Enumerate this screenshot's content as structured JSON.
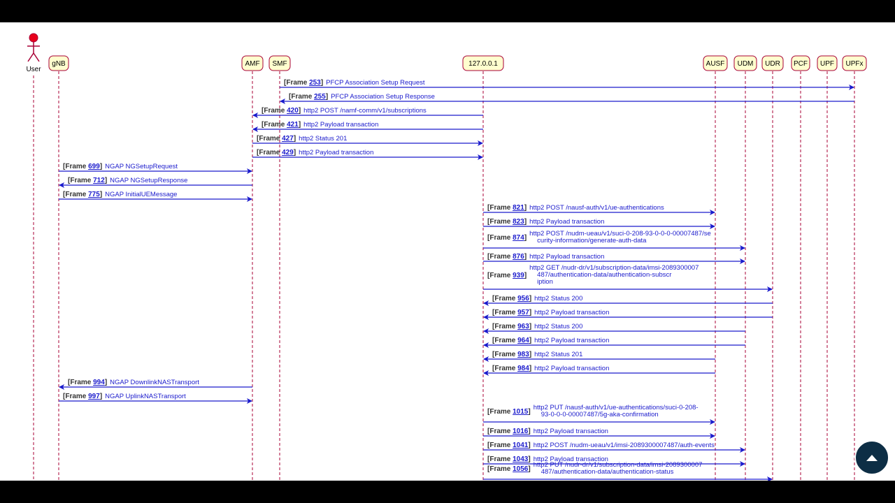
{
  "diagram": {
    "actor": {
      "label": "User"
    },
    "participants": [
      {
        "id": "gnb",
        "label": "gNB"
      },
      {
        "id": "amf",
        "label": "AMF"
      },
      {
        "id": "smf",
        "label": "SMF"
      },
      {
        "id": "ip",
        "label": "127.0.0.1"
      },
      {
        "id": "ausf",
        "label": "AUSF"
      },
      {
        "id": "udm",
        "label": "UDM"
      },
      {
        "id": "udr",
        "label": "UDR"
      },
      {
        "id": "pcf",
        "label": "PCF"
      },
      {
        "id": "upf",
        "label": "UPF"
      },
      {
        "id": "upfx",
        "label": "UPFx"
      }
    ],
    "messages": [
      {
        "frame": "253",
        "from": "smf",
        "to": "upfx",
        "lines": [
          "PFCP Association Setup Request"
        ]
      },
      {
        "frame": "255",
        "from": "upfx",
        "to": "smf",
        "lines": [
          "PFCP Association Setup Response"
        ]
      },
      {
        "frame": "420",
        "from": "ip",
        "to": "amf",
        "lines": [
          "http2 POST /namf-comm/v1/subscriptions"
        ]
      },
      {
        "frame": "421",
        "from": "ip",
        "to": "amf",
        "lines": [
          "http2 Payload transaction"
        ]
      },
      {
        "frame": "427",
        "from": "amf",
        "to": "ip",
        "lines": [
          "http2 Status 201"
        ]
      },
      {
        "frame": "429",
        "from": "amf",
        "to": "ip",
        "lines": [
          "http2 Payload transaction"
        ]
      },
      {
        "frame": "699",
        "from": "gnb",
        "to": "amf",
        "lines": [
          "NGAP NGSetupRequest"
        ]
      },
      {
        "frame": "712",
        "from": "amf",
        "to": "gnb",
        "lines": [
          "NGAP NGSetupResponse"
        ]
      },
      {
        "frame": "775",
        "from": "gnb",
        "to": "amf",
        "lines": [
          "NGAP InitialUEMessage"
        ]
      },
      {
        "frame": "821",
        "from": "ip",
        "to": "ausf",
        "lines": [
          "http2 POST /nausf-auth/v1/ue-authentications"
        ]
      },
      {
        "frame": "823",
        "from": "ip",
        "to": "ausf",
        "lines": [
          "http2 Payload transaction"
        ]
      },
      {
        "frame": "874",
        "from": "ip",
        "to": "udm",
        "lines": [
          "http2 POST /nudm-ueau/v1/suci-0-208-93-0-0-0-00007487/se",
          "curity-information/generate-auth-data"
        ]
      },
      {
        "frame": "876",
        "from": "ip",
        "to": "udm",
        "lines": [
          "http2 Payload transaction"
        ]
      },
      {
        "frame": "939",
        "from": "ip",
        "to": "udr",
        "lines": [
          "http2 GET /nudr-dr/v1/subscription-data/imsi-2089300007",
          "487/authentication-data/authentication-subscr",
          "iption"
        ]
      },
      {
        "frame": "956",
        "from": "udr",
        "to": "ip",
        "lines": [
          "http2 Status 200"
        ]
      },
      {
        "frame": "957",
        "from": "udr",
        "to": "ip",
        "lines": [
          "http2 Payload transaction"
        ]
      },
      {
        "frame": "963",
        "from": "udm",
        "to": "ip",
        "lines": [
          "http2 Status 200"
        ]
      },
      {
        "frame": "964",
        "from": "udm",
        "to": "ip",
        "lines": [
          "http2 Payload transaction"
        ]
      },
      {
        "frame": "983",
        "from": "ausf",
        "to": "ip",
        "lines": [
          "http2 Status 201"
        ]
      },
      {
        "frame": "984",
        "from": "ausf",
        "to": "ip",
        "lines": [
          "http2 Payload transaction"
        ]
      },
      {
        "frame": "994",
        "from": "amf",
        "to": "gnb",
        "lines": [
          "NGAP DownlinkNASTransport"
        ]
      },
      {
        "frame": "997",
        "from": "gnb",
        "to": "amf",
        "lines": [
          "NGAP UplinkNASTransport"
        ]
      },
      {
        "frame": "1015",
        "from": "ip",
        "to": "ausf",
        "lines": [
          "http2 PUT /nausf-auth/v1/ue-authentications/suci-0-208-",
          "93-0-0-0-00007487/5g-aka-confirmation"
        ]
      },
      {
        "frame": "1016",
        "from": "ip",
        "to": "ausf",
        "lines": [
          "http2 Payload transaction"
        ]
      },
      {
        "frame": "1041",
        "from": "ip",
        "to": "udm",
        "lines": [
          "http2 POST /nudm-ueau/v1/imsi-2089300007487/auth-events"
        ]
      },
      {
        "frame": "1043",
        "from": "ip",
        "to": "udm",
        "lines": [
          "http2 Payload transaction"
        ]
      },
      {
        "frame": "1056",
        "from": "ip",
        "to": "udr",
        "lines": [
          "http2 PUT /nudr-dr/v1/subscription-data/imsi-2089300007",
          "487/authentication-data/authentication-status"
        ]
      }
    ]
  },
  "frame_prefix": "Frame",
  "colors": {
    "arrow": "#1a1acc",
    "lifeline": "#a80036",
    "box_fill": "#fefece",
    "actor": "#e8001c"
  },
  "scroll_top_button": {
    "icon": "arrow-up-icon"
  }
}
